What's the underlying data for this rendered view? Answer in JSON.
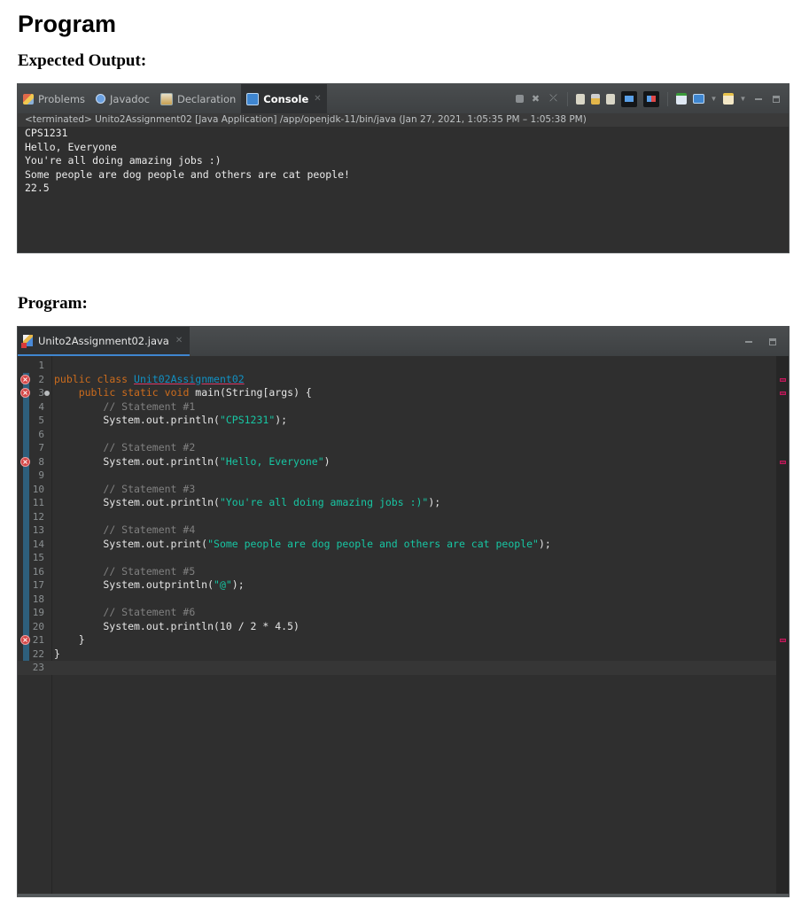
{
  "headings": {
    "title": "Program",
    "expected_output": "Expected Output:",
    "program": "Program:"
  },
  "console_panel": {
    "tabs": [
      {
        "label": "Problems",
        "icon": "problems-icon",
        "active": false
      },
      {
        "label": "Javadoc",
        "icon": "javadoc-icon",
        "active": false
      },
      {
        "label": "Declaration",
        "icon": "declaration-icon",
        "active": false
      },
      {
        "label": "Console",
        "icon": "console-icon",
        "active": true
      }
    ],
    "toolbar_icons": [
      "terminate-icon",
      "remove-launch-icon",
      "remove-all-terminated-icon",
      "clear-console-icon",
      "scroll-lock-icon",
      "word-wrap-icon",
      "pin-console-icon",
      "show-console-on-error-icon",
      "new-console-icon",
      "display-selected-console-icon",
      "open-console-icon",
      "minimize-icon",
      "maximize-icon"
    ],
    "status_line": "<terminated> Unito2Assignment02 [Java Application] /app/openjdk-11/bin/java  (Jan 27, 2021, 1:05:35 PM – 1:05:38 PM)",
    "output_lines": [
      "CPS1231",
      "Hello, Everyone",
      "You're all doing amazing jobs :)",
      "Some people are dog people and others are cat people!",
      "22.5"
    ]
  },
  "editor_panel": {
    "file_tab": "Unito2Assignment02.java",
    "lines": [
      {
        "n": "1",
        "code": ""
      },
      {
        "n": "2",
        "code": "public class Unit02Assignment02",
        "error": true
      },
      {
        "n": "3",
        "code": "    public static void main(String[args) {",
        "error": true,
        "fold": true
      },
      {
        "n": "4",
        "code": "        // Statement #1"
      },
      {
        "n": "5",
        "code": "        System.out.println(\"CPS1231\");"
      },
      {
        "n": "6",
        "code": ""
      },
      {
        "n": "7",
        "code": "        // Statement #2"
      },
      {
        "n": "8",
        "code": "        System.out.println(\"Hello, Everyone\")",
        "error": true
      },
      {
        "n": "9",
        "code": ""
      },
      {
        "n": "10",
        "code": "        // Statement #3"
      },
      {
        "n": "11",
        "code": "        System.out.println(\"You're all doing amazing jobs :)\");"
      },
      {
        "n": "12",
        "code": ""
      },
      {
        "n": "13",
        "code": "        // Statement #4"
      },
      {
        "n": "14",
        "code": "        System.out.print(\"Some people are dog people and others are cat people\");"
      },
      {
        "n": "15",
        "code": ""
      },
      {
        "n": "16",
        "code": "        // Statement #5"
      },
      {
        "n": "17",
        "code": "        System.outprintln(\"@\");"
      },
      {
        "n": "18",
        "code": ""
      },
      {
        "n": "19",
        "code": "        // Statement #6"
      },
      {
        "n": "20",
        "code": "        System.out.println(10 / 2 * 4.5)"
      },
      {
        "n": "21",
        "code": "    }",
        "error": true
      },
      {
        "n": "22",
        "code": "}"
      },
      {
        "n": "23",
        "code": "",
        "current": true
      }
    ],
    "overview_error_lines": [
      2,
      3,
      8,
      21
    ]
  },
  "colors": {
    "keyword": "#cc6c1d",
    "class_name": "#1290c3",
    "comment": "#808080",
    "string": "#17c6a3",
    "error": "#d54747"
  }
}
